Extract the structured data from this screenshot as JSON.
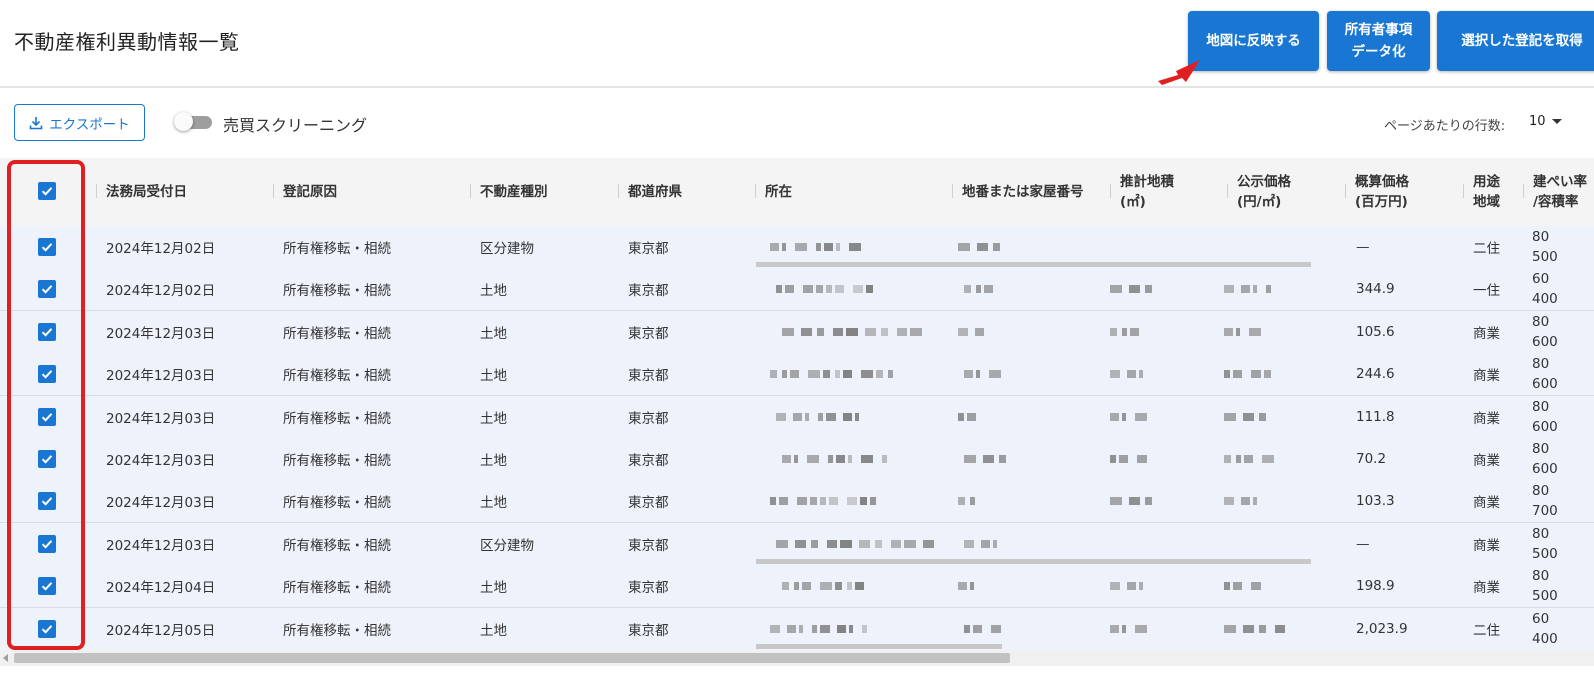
{
  "page": {
    "title": "不動産権利異動情報一覧"
  },
  "header_buttons": {
    "map": "地図に反映する",
    "owner_line1": "所有者事項",
    "owner_line2": "データ化",
    "selected": "選択した登記を取得"
  },
  "toolbar": {
    "export_label": "エクスポート",
    "screening_label": "売買スクリーニング",
    "rows_per_page_label": "ページあたりの行数:",
    "rows_per_page_value": "10"
  },
  "columns": {
    "date": "法務局受付日",
    "cause": "登記原因",
    "type": "不動産種別",
    "pref": "都道府県",
    "location": "所在",
    "lot": "地番または家屋番号",
    "area_1": "推計地積",
    "area_2": "(㎡)",
    "public_1": "公示価格",
    "public_2": "(円/㎡)",
    "approx_1": "概算価格",
    "approx_2": "(百万円)",
    "zone_1": "用途",
    "zone_2": "地域",
    "ratio_1": "建ぺい率",
    "ratio_2": "/容積率"
  },
  "rows": [
    {
      "date": "2024年12月02日",
      "cause": "所有権移転・相続",
      "type": "区分建物",
      "pref": "東京都",
      "approx": "—",
      "zone": "二住",
      "ratio_1": "80",
      "ratio_2": "500"
    },
    {
      "date": "2024年12月02日",
      "cause": "所有権移転・相続",
      "type": "土地",
      "pref": "東京都",
      "approx": "344.9",
      "zone": "一住",
      "ratio_1": "60",
      "ratio_2": "400"
    },
    {
      "date": "2024年12月03日",
      "cause": "所有権移転・相続",
      "type": "土地",
      "pref": "東京都",
      "approx": "105.6",
      "zone": "商業",
      "ratio_1": "80",
      "ratio_2": "600"
    },
    {
      "date": "2024年12月03日",
      "cause": "所有権移転・相続",
      "type": "土地",
      "pref": "東京都",
      "approx": "244.6",
      "zone": "商業",
      "ratio_1": "80",
      "ratio_2": "600"
    },
    {
      "date": "2024年12月03日",
      "cause": "所有権移転・相続",
      "type": "土地",
      "pref": "東京都",
      "approx": "111.8",
      "zone": "商業",
      "ratio_1": "80",
      "ratio_2": "600"
    },
    {
      "date": "2024年12月03日",
      "cause": "所有権移転・相続",
      "type": "土地",
      "pref": "東京都",
      "approx": "70.2",
      "zone": "商業",
      "ratio_1": "80",
      "ratio_2": "600"
    },
    {
      "date": "2024年12月03日",
      "cause": "所有権移転・相続",
      "type": "土地",
      "pref": "東京都",
      "approx": "103.3",
      "zone": "商業",
      "ratio_1": "80",
      "ratio_2": "700"
    },
    {
      "date": "2024年12月03日",
      "cause": "所有権移転・相続",
      "type": "区分建物",
      "pref": "東京都",
      "approx": "—",
      "zone": "商業",
      "ratio_1": "80",
      "ratio_2": "500"
    },
    {
      "date": "2024年12月04日",
      "cause": "所有権移転・相続",
      "type": "土地",
      "pref": "東京都",
      "approx": "198.9",
      "zone": "商業",
      "ratio_1": "80",
      "ratio_2": "500"
    },
    {
      "date": "2024年12月05日",
      "cause": "所有権移転・相続",
      "type": "土地",
      "pref": "東京都",
      "approx": "2,023.9",
      "zone": "二住",
      "ratio_1": "60",
      "ratio_2": "400"
    }
  ],
  "colors": {
    "primary": "#1976d2",
    "highlight": "#e02020",
    "row_bg": "#eef3fb"
  },
  "icons": {
    "export": "download-icon",
    "checkbox": "check-icon",
    "arrow": "red-arrow-icon"
  }
}
